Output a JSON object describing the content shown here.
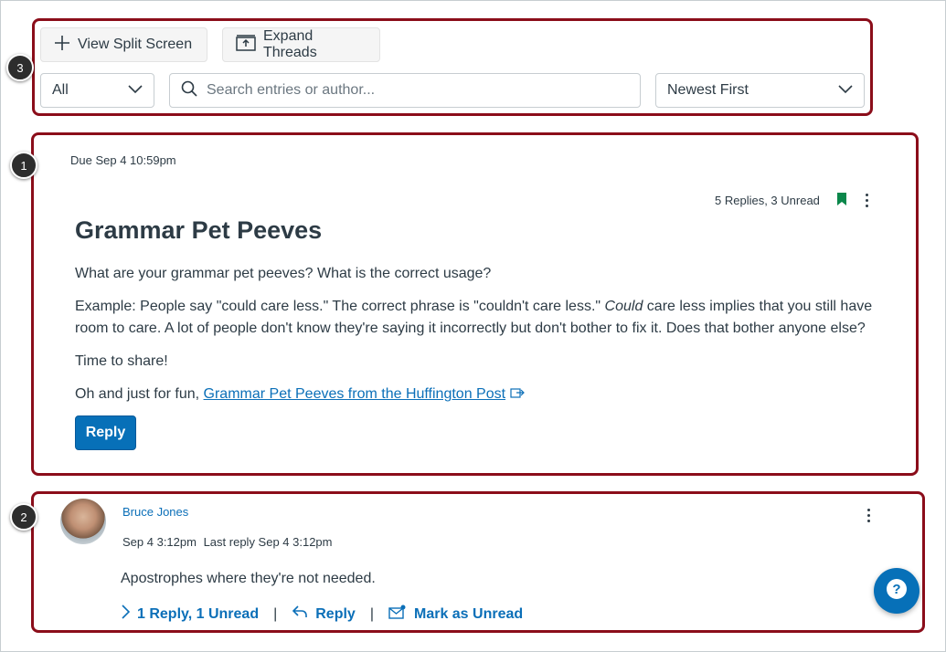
{
  "toolbar": {
    "split_screen_label": "View Split Screen",
    "expand_threads_label": "Expand Threads",
    "filter_value": "All",
    "search_placeholder": "Search entries or author...",
    "sort_value": "Newest First"
  },
  "callouts": [
    "1",
    "2",
    "3"
  ],
  "topic": {
    "due": "Due Sep 4 10:59pm",
    "replies_summary": "5 Replies, 3 Unread",
    "title": "Grammar Pet Peeves",
    "para1": "What are your grammar pet peeves? What is the correct usage?",
    "para2_start": "Example: People say \"could care less.\" The correct phrase is \"couldn't care less.\" ",
    "para2_italic": "Could",
    "para2_end": " care less implies that you still have room to care. A lot of people don't know they're saying it incorrectly but don't bother to fix it. Does that bother anyone else?",
    "para3": "Time to share!",
    "para4_prefix": "Oh and just for fun, ",
    "para4_link": "Grammar Pet Peeves from the Huffington Post",
    "reply_label": "Reply"
  },
  "entry": {
    "author": "Bruce Jones",
    "posted": "Sep 4 3:12pm",
    "last_reply": "Last reply Sep 4 3:12pm",
    "message": "Apostrophes where they're not needed.",
    "replies_link": "1 Reply, 1 Unread",
    "reply_label": "Reply",
    "mark_unread_label": "Mark as Unread",
    "separator": "|"
  },
  "colors": {
    "callout_border": "#8b0d1a",
    "primary_blue": "#0770b8",
    "link_blue": "#0b6fb8",
    "bookmark_green": "#0b874b"
  }
}
